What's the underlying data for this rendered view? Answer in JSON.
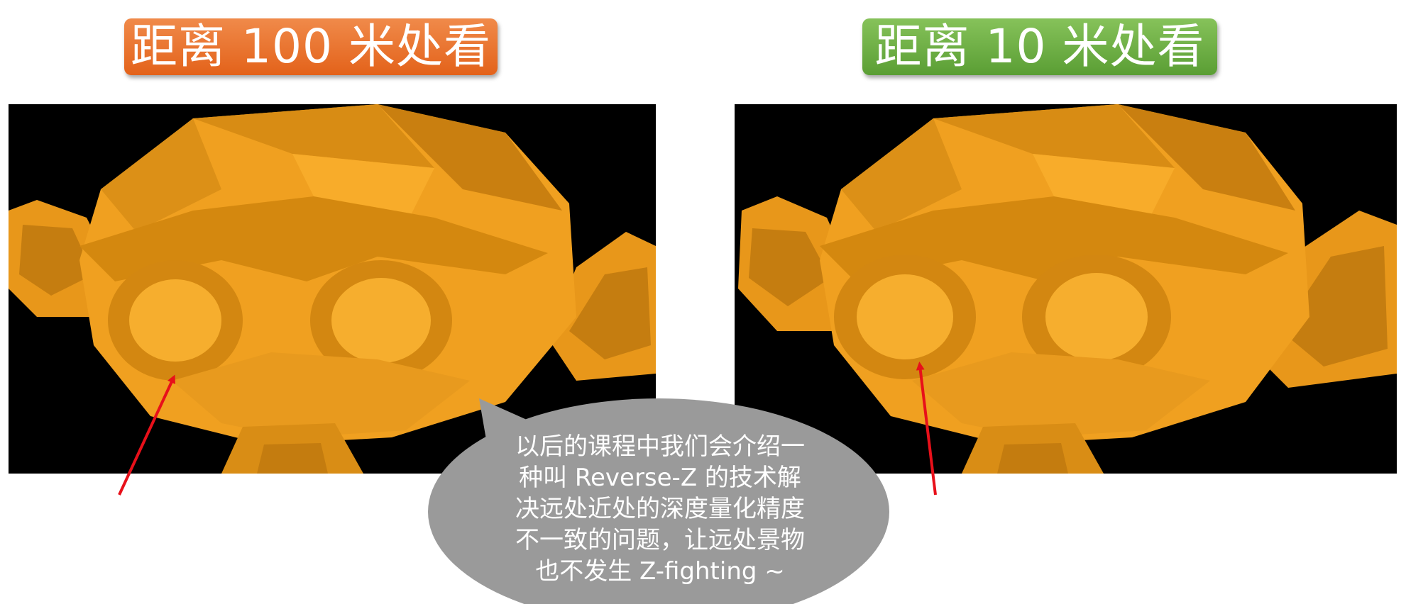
{
  "labels": {
    "left": "距离 100 米处看",
    "right": "距离 10 米处看"
  },
  "callout": {
    "lines": [
      "以后的课程中我们会介绍一",
      "种叫  Reverse-Z  的技术解",
      "决远处近处的深度量化精度",
      "不一致的问题，让远处景物",
      "也不发生  Z-fighting  ~"
    ]
  },
  "colors": {
    "left_label": "#e86d25",
    "right_label": "#6aaa40",
    "model": "#f0a020",
    "background": "#000000",
    "arrow": "#e8101a",
    "callout": "#9a9a9a"
  }
}
